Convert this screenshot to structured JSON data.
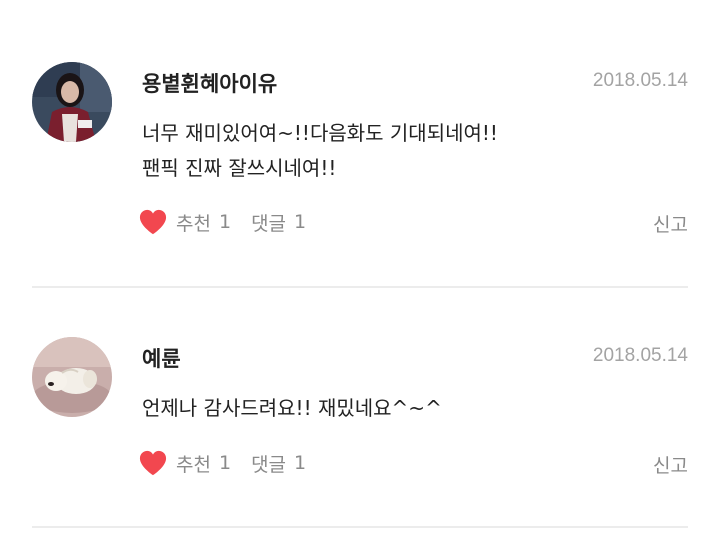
{
  "comments": [
    {
      "author": "용볕휜혜아이유",
      "date": "2018.05.14",
      "body_lines": [
        "너무 재미있어여~!!다음화도 기대되네여!!",
        "팬픽 진짜 잘쓰시네여!!"
      ],
      "like_label": "추천",
      "like_count": "1",
      "reply_label": "댓글",
      "reply_count": "1",
      "report_label": "신고"
    },
    {
      "author": "예륜",
      "date": "2018.05.14",
      "body_lines": [
        "언제나 감사드려요!! 재밌네요^~^"
      ],
      "like_label": "추천",
      "like_count": "1",
      "reply_label": "댓글",
      "reply_count": "1",
      "report_label": "신고"
    }
  ],
  "colors": {
    "heart": "#f2474f",
    "meta_text": "#8a8a8a",
    "date_text": "#a3a3a3",
    "divider": "#ececec"
  },
  "icons": {
    "like": "heart-icon"
  }
}
